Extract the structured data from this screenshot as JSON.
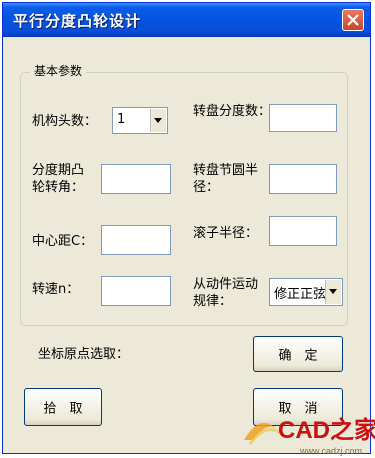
{
  "window": {
    "title": "平行分度凸轮设计"
  },
  "group": {
    "legend": "基本参数"
  },
  "fields": {
    "heads": {
      "label": "机构头数：",
      "value": "1"
    },
    "turret_deg": {
      "label": "转盘分度数："
    },
    "index_angle": {
      "label": "分度期凸轮转角："
    },
    "pitch_radius": {
      "label": "转盘节圆半径："
    },
    "center_dist": {
      "label": "中心距C："
    },
    "roller_radius": {
      "label": "滚子半径："
    },
    "speed": {
      "label": "转速n："
    },
    "motion_law": {
      "label": "从动件运动规律：",
      "value": "修正正弦"
    }
  },
  "origin_label": "坐标原点选取：",
  "buttons": {
    "ok": "确　定",
    "pick": "拾　取",
    "cancel": "取　消"
  },
  "watermark": {
    "text": "CAD之家",
    "sub": "www.cadzj.com"
  },
  "colors": {
    "title_blue": "#0553e3",
    "close_red": "#d4573b",
    "dialog": "#ece9d8"
  }
}
